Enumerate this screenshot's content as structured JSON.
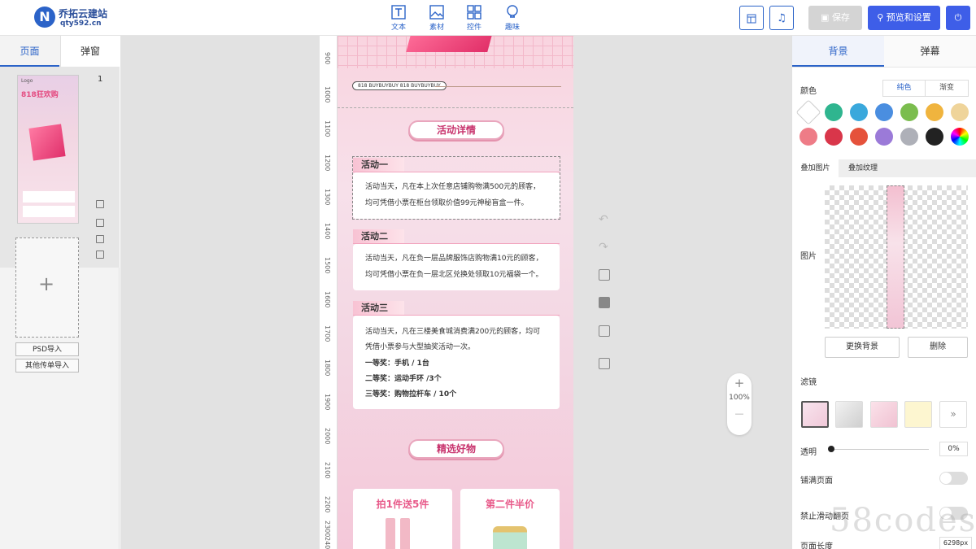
{
  "brand": {
    "name": "乔拓云建站",
    "url": "qty592.cn",
    "logo_letter": "N"
  },
  "toolbar": {
    "items": [
      {
        "label": "文本",
        "icon": "text-icon"
      },
      {
        "label": "素材",
        "icon": "image-icon"
      },
      {
        "label": "控件",
        "icon": "widget-icon"
      },
      {
        "label": "趣味",
        "icon": "bulb-icon"
      }
    ]
  },
  "header": {
    "save_label": "保存",
    "preview_label": "预览和设置"
  },
  "left": {
    "tabs": [
      "页面",
      "弹窗"
    ],
    "page_number": "1",
    "thumb": {
      "logo": "Logo",
      "headline": "818狂欢购"
    },
    "import_psd": "PSD导入",
    "import_other": "其他传单导入"
  },
  "ruler": {
    "ticks": [
      "900",
      "1000",
      "1100",
      "1200",
      "1300",
      "1400",
      "1500",
      "1600",
      "1700",
      "1800",
      "1900",
      "2000",
      "2100",
      "2200",
      "2300",
      "2400"
    ]
  },
  "page": {
    "banner_text": "818 BUYBUYBUY 818 BUYBUYBUY",
    "section1_title": "活动详情",
    "cards": [
      {
        "tag": "活动一",
        "lines": [
          "活动当天，凡在本上次任意店铺购物满500元的顾客，",
          "均可凭借小票在柜台领取价值99元神秘盲盒一件。"
        ]
      },
      {
        "tag": "活动二",
        "lines": [
          "活动当天，凡在负一层品牌服饰店购物满10元的顾客，",
          "均可凭借小票在负一层北区兑换处领取10元福袋一个。"
        ]
      },
      {
        "tag": "活动三",
        "lines": [
          "活动当天，凡在三楼美食城消费满200元的顾客，均可",
          "凭借小票参与大型抽奖活动一次。"
        ],
        "prizes": [
          "一等奖：手机 / 1台",
          "二等奖：运动手环 /3个",
          "三等奖：购物拉杆车 / 10个"
        ]
      }
    ],
    "section2_title": "精选好物",
    "products": [
      "拍1件送5件",
      "第二件半价"
    ]
  },
  "zoom": {
    "plus": "+",
    "level": "100%",
    "minus": "—"
  },
  "right": {
    "tabs": [
      "背景",
      "弹幕"
    ],
    "color_label": "颜色",
    "color_modes": [
      "纯色",
      "渐变"
    ],
    "swatches": [
      "#ffffff",
      "#2fb58f",
      "#3aa8dc",
      "#4a8ee0",
      "#7bbd4e",
      "#f0b43e",
      "#efd49a",
      "#ee7c87",
      "#d9364a",
      "#e5523b",
      "#9b7ad8",
      "#aeb0b8",
      "#222222",
      "rainbow"
    ],
    "overlay_tabs": [
      "叠加图片",
      "叠加纹理"
    ],
    "image_label": "图片",
    "replace_bg": "更换背景",
    "delete": "删除",
    "filter_label": "滤镜",
    "filter_more": "»",
    "opacity_label": "透明",
    "opacity_value": "0%",
    "tile_label": "铺满页面",
    "noslide_label": "禁止滑动翻页",
    "length_label": "页面长度",
    "length_value": "6298px"
  },
  "watermark": "58codes"
}
